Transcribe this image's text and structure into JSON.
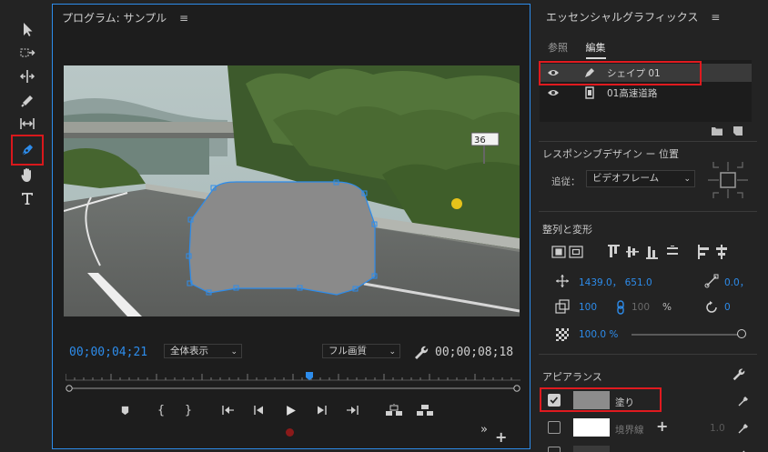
{
  "program_monitor": {
    "title": "プログラム: サンプル",
    "current_timecode": "00;00;04;21",
    "duration_timecode": "00;00;08;18",
    "zoom_select": "全体表示",
    "quality_select": "フル画質",
    "sign_text": "36"
  },
  "tools": [
    "selection-tool",
    "track-select-tool",
    "ripple-edit-tool",
    "razor-tool",
    "slip-tool",
    "pen-tool",
    "hand-tool",
    "type-tool"
  ],
  "essential_graphics": {
    "title": "エッセンシャルグラフィックス",
    "tabs": [
      {
        "label": "参照"
      },
      {
        "label": "編集"
      }
    ],
    "layers": [
      {
        "name": "シェイプ 01",
        "selected": true
      },
      {
        "name": "01高速道路",
        "selected": false
      }
    ],
    "responsive": {
      "title": "レスポンシブデザイン ー 位置",
      "follow_label": "追従：",
      "follow_value": "ビデオフレーム"
    },
    "align": {
      "title": "整列と変形",
      "position": "1439.0， 651.0",
      "rotation_anchor": "0.0，",
      "scale": "100",
      "scale_locked": "100",
      "percent": "%",
      "rotation": "0",
      "opacity": "100.0 %",
      "opacity_value": 1.0
    },
    "appearance": {
      "title": "アピアランス",
      "fill_label": "塗り",
      "stroke_label": "境界線",
      "stroke_width": "1.0",
      "fill_color": "#8c8c8c",
      "stroke_color": "#ffffff"
    }
  }
}
